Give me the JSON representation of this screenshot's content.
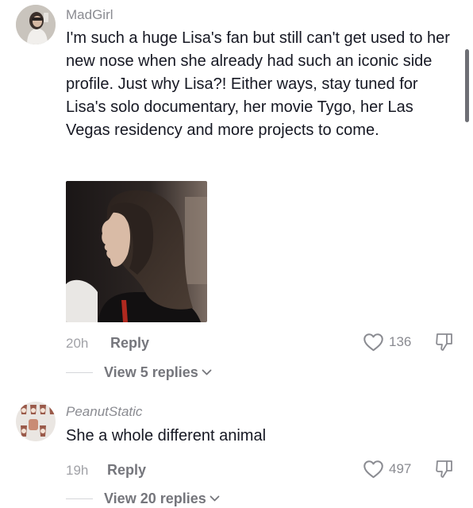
{
  "comments": [
    {
      "username": "MadGirl",
      "text": "I'm such a huge Lisa's fan but still can't get used to her new nose when she already had such an iconic side profile. Just why Lisa?! Either ways, stay tuned for Lisa's solo documentary, her movie Tygo, her Las Vegas residency and more projects to come.",
      "time": "20h",
      "reply_label": "Reply",
      "likes": "136",
      "view_replies_label": "View 5 replies"
    },
    {
      "username": "PeanutStatic",
      "text": "She a whole different animal",
      "time": "19h",
      "reply_label": "Reply",
      "likes": "497",
      "view_replies_label": "View 20 replies"
    }
  ],
  "icons": {
    "like": "heart-outline-icon",
    "dislike": "thumbs-down-icon",
    "expand": "chevron-down-icon"
  },
  "colors": {
    "text_primary": "#161823",
    "text_secondary": "#8a8b91",
    "action_text": "#75767c"
  }
}
